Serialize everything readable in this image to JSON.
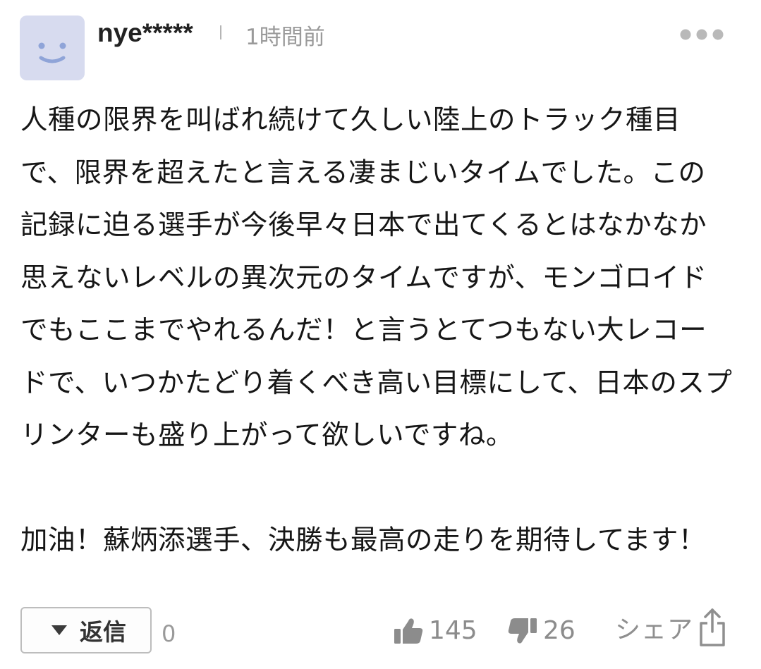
{
  "comment": {
    "username": "nye*****",
    "timestamp": "1時間前",
    "paragraphs": [
      "人種の限界を叫ばれ続けて久しい陸上のトラック種目で、限界を超えたと言える凄まじいタイムでした。この記録に迫る選手が今後早々日本で出てくるとはなかなか思えないレベルの異次元のタイムですが、モンゴロイドでもここまでやれるんだ！と言うとてつもない大レコードで、いつかたどり着くべき高い目標にして、日本のスプリンターも盛り上がって欲しいですね。",
      "加油！蘇炳添選手、決勝も最高の走りを期待してます！"
    ]
  },
  "actions": {
    "reply_label": "返信",
    "reply_count": "0",
    "like_count": "145",
    "dislike_count": "26",
    "share_label": "シェア"
  },
  "icons": {
    "avatar": "smiley-face-icon",
    "more": "more-dots-icon",
    "reply": "triangle-down-icon",
    "like": "thumbs-up-icon",
    "dislike": "thumbs-down-icon",
    "share": "share-icon"
  },
  "colors": {
    "avatar_bg": "#d7dbef",
    "avatar_face": "#8fa4d8",
    "muted_text": "#9a9a9a"
  }
}
